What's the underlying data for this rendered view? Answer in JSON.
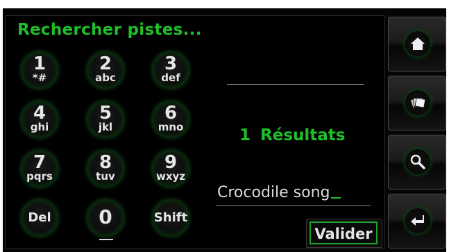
{
  "header": {
    "title": "Rechercher pistes..."
  },
  "keypad": {
    "keys": [
      {
        "digit": "1",
        "letters": "*#"
      },
      {
        "digit": "2",
        "letters": "abc"
      },
      {
        "digit": "3",
        "letters": "def"
      },
      {
        "digit": "4",
        "letters": "ghi"
      },
      {
        "digit": "5",
        "letters": "jkl"
      },
      {
        "digit": "6",
        "letters": "mno"
      },
      {
        "digit": "7",
        "letters": "pqrs"
      },
      {
        "digit": "8",
        "letters": "tuv"
      },
      {
        "digit": "9",
        "letters": "wxyz"
      }
    ],
    "del_label": "Del",
    "zero_label": "0",
    "shift_label": "Shift"
  },
  "results": {
    "count": "1",
    "label": "Résultats"
  },
  "search": {
    "value": "Crocodile song"
  },
  "actions": {
    "validate_label": "Valider"
  },
  "sidebar": {
    "buttons": [
      {
        "icon": "home-icon"
      },
      {
        "icon": "photos-icon"
      },
      {
        "icon": "search-icon"
      },
      {
        "icon": "enter-icon"
      }
    ]
  },
  "colors": {
    "accent": "#1fbf2a",
    "background": "#000000",
    "text": "#e6e6e6"
  }
}
